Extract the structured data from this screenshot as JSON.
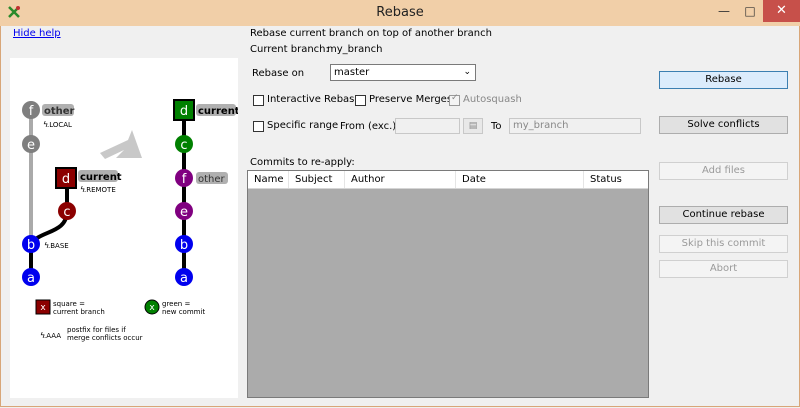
{
  "window": {
    "title": "Rebase"
  },
  "help": {
    "hide_link": "Hide help"
  },
  "diagram": {
    "left_labels": {
      "other": "other",
      "local": ".LOCAL",
      "current": "current",
      "remote": ".REMOTE",
      "base": ".BASE"
    },
    "right_labels": {
      "current": "current",
      "other": "other"
    },
    "nodes_left": [
      "f",
      "e",
      "d",
      "c",
      "b",
      "a"
    ],
    "nodes_right": [
      "d",
      "c",
      "f",
      "e",
      "b",
      "a"
    ],
    "legend": {
      "square_sym": "x",
      "square_text1": "square =",
      "square_text2": "current branch",
      "green_sym": "x",
      "green_text1": "green =",
      "green_text2": "new commit",
      "postfix_sym": ".AAA",
      "postfix_text1": "postfix for files if",
      "postfix_text2": "merge conflicts occur"
    },
    "colors": {
      "gray": "#7f7f7f",
      "red": "#8b0000",
      "blue": "#0000ee",
      "green": "#008000",
      "purple": "#800080"
    }
  },
  "form": {
    "heading": "Rebase current branch on top of another branch",
    "current_branch_label": "Current branch:",
    "current_branch_value": "my_branch",
    "rebase_on_label": "Rebase on",
    "rebase_on_value": "master",
    "interactive_label": "Interactive Rebase",
    "preserve_merges_label": "Preserve Merges",
    "autosquash_label": "Autosquash",
    "specific_range_label": "Specific range",
    "from_label": "From (exc.)",
    "to_label": "To",
    "to_value": "my_branch",
    "commits_label": "Commits to re-apply:",
    "columns": [
      "Name",
      "Subject",
      "Author",
      "Date",
      "Status"
    ]
  },
  "buttons": {
    "rebase": "Rebase",
    "solve_conflicts": "Solve conflicts",
    "add_files": "Add files",
    "continue_rebase": "Continue rebase",
    "skip_commit": "Skip this commit",
    "abort": "Abort"
  }
}
